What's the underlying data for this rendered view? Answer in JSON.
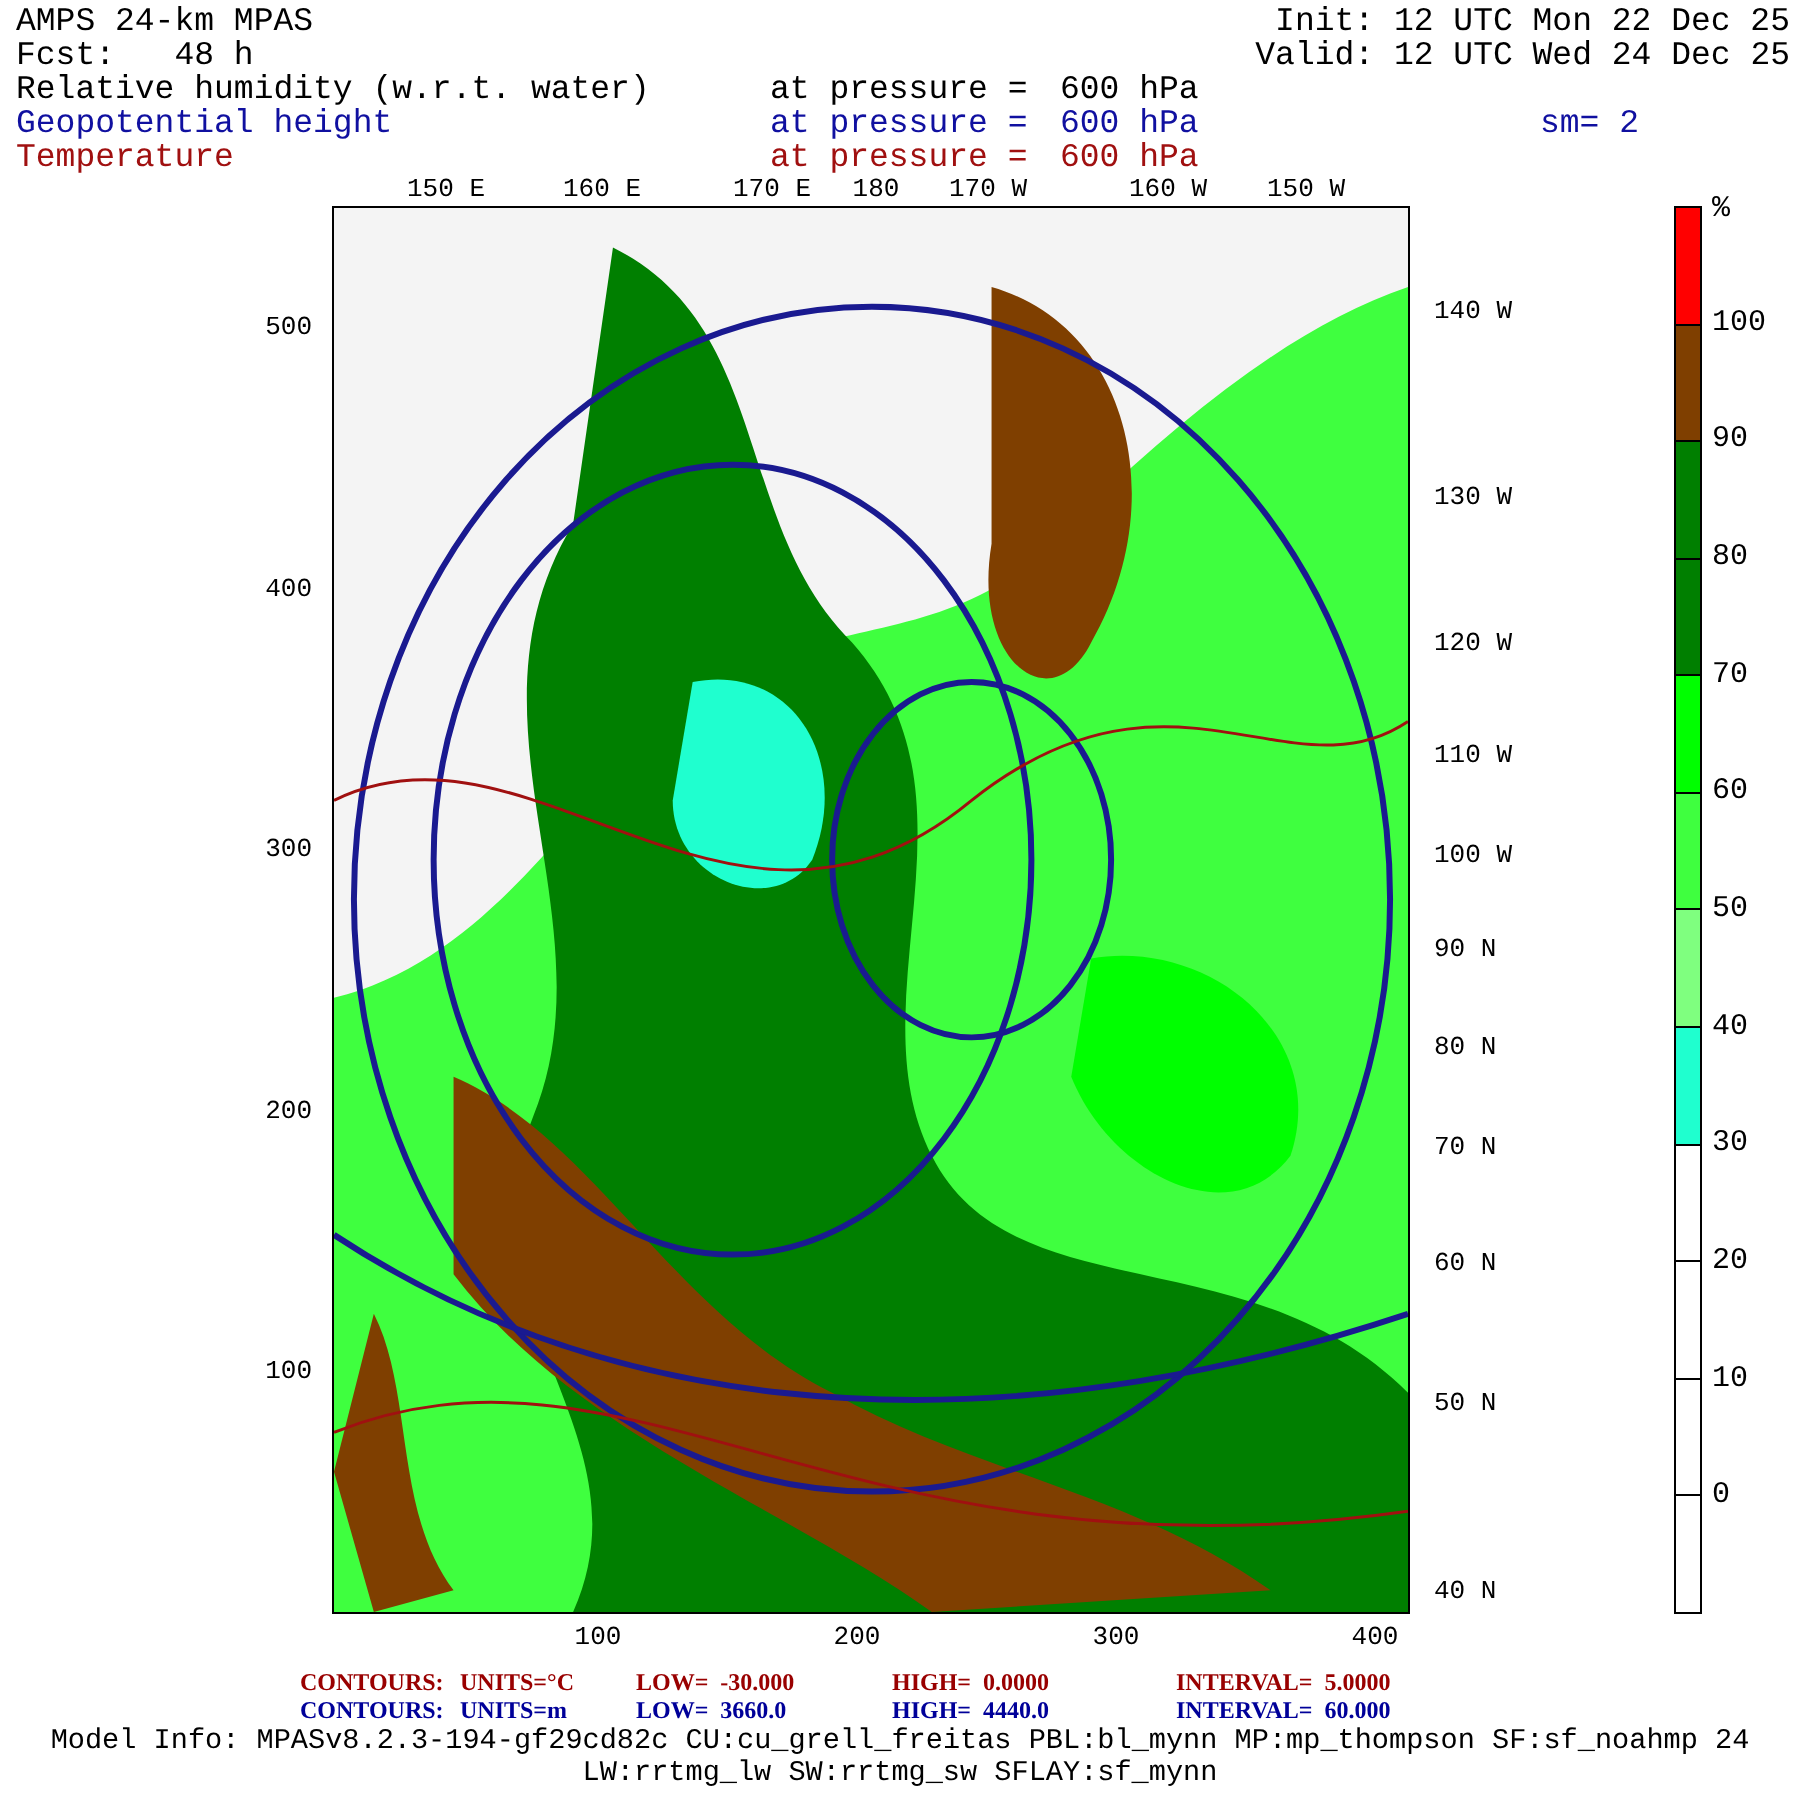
{
  "header": {
    "title": "AMPS 24-km MPAS",
    "init": "Init: 12 UTC Mon 22 Dec 25",
    "forecast": "Fcst:   48 h",
    "valid": "Valid: 12 UTC Wed 24 Dec 25"
  },
  "fields": [
    {
      "name": "Relative humidity (w.r.t. water)",
      "pressure_label": "at pressure =",
      "pressure": "600 hPa",
      "color": "#000000"
    },
    {
      "name": "Geopotential height",
      "pressure_label": "at pressure =",
      "pressure": "600 hPa",
      "color": "#1010a0"
    },
    {
      "name": "Temperature",
      "pressure_label": "at pressure =",
      "pressure": "600 hPa",
      "color": "#a01010"
    }
  ],
  "smoothing": "sm= 2",
  "map": {
    "kind": "picture",
    "top_ticks": [
      "150 E",
      "160 E",
      "170 E",
      "180",
      "170 W",
      "160 W",
      "150 W"
    ],
    "right_ticks": [
      "140 W",
      "130 W",
      "120 W",
      "110 W",
      "100 W",
      "90 N",
      "80 N",
      "70 N",
      "60 N",
      "50 N",
      "40 N"
    ],
    "left_ticks": [
      "500",
      "400",
      "300",
      "200",
      "100"
    ],
    "bottom_ticks": [
      "100",
      "200",
      "300",
      "400"
    ]
  },
  "colorbar": {
    "unit": "%",
    "bins": [
      {
        "color": "#ff0000"
      },
      {
        "color": "#7f3f00"
      },
      {
        "color": "#007f00"
      },
      {
        "color": "#007f00"
      },
      {
        "color": "#00ff00"
      },
      {
        "color": "#3fff3f"
      },
      {
        "color": "#7fff7f"
      },
      {
        "color": "#1fffcf"
      },
      {
        "color": "#ffffff"
      },
      {
        "color": "#ffffff"
      },
      {
        "color": "#ffffff"
      },
      {
        "color": "#ffffff"
      }
    ],
    "labels": [
      "100",
      "90",
      "80",
      "70",
      "60",
      "50",
      "40",
      "30",
      "20",
      "10",
      "0"
    ]
  },
  "contours": [
    {
      "color": "#990000",
      "columns": [
        {
          "label": "CONTOURS:"
        },
        {
          "label": "UNITS=°C"
        },
        {
          "label": "LOW=",
          "value": "-30.000"
        },
        {
          "label": "HIGH=",
          "value": "0.0000"
        },
        {
          "label": "INTERVAL=",
          "value": "5.0000"
        }
      ]
    },
    {
      "color": "#000099",
      "columns": [
        {
          "label": "CONTOURS:"
        },
        {
          "label": "UNITS=m"
        },
        {
          "label": "LOW=",
          "value": "3660.0"
        },
        {
          "label": "HIGH=",
          "value": "4440.0"
        },
        {
          "label": "INTERVAL=",
          "value": "60.000"
        }
      ]
    }
  ],
  "model_info": [
    "Model Info: MPASv8.2.3-194-gf29cd82c CU:cu_grell_freitas PBL:bl_mynn MP:mp_thompson SF:sf_noahmp 24",
    "LW:rrtmg_lw SW:rrtmg_sw SFLAY:sf_mynn"
  ]
}
